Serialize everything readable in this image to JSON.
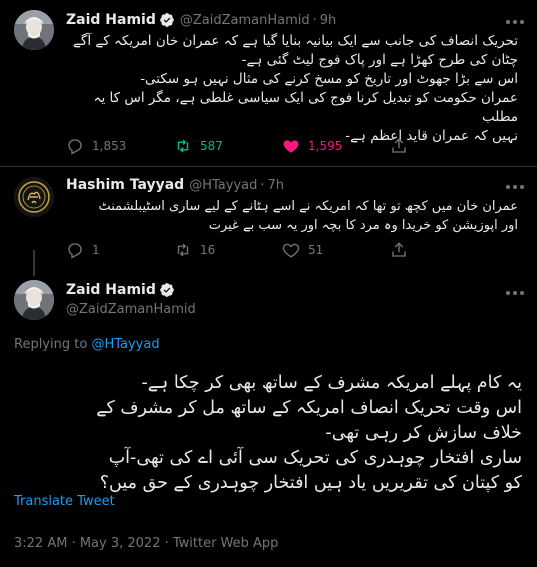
{
  "tweet1": {
    "name": "Zaid Hamid",
    "handle": "@ZaidZamanHamid",
    "sep": "·",
    "time": "9h",
    "lines": [
      "تحریک انصاف کی جانب سے ایک بیانیہ  بنایا گیا ہے کہ عمران خان امریکہ کے آگے",
      "چٹان کی طرح کھڑا ہے اور پاک فوج لیٹ گئی ہے-",
      "اس سے بڑا جھوٹ اور تاریخ کو مسخ کرنے کی مثال نہیں ہو سکتی-",
      "عمران حکومت کو تبدیل کرنا فوج کی ایک سیاسی غلطی ہے، مگر اس کا یہ مطلب",
      "نہیں کہ عمران قاید اعظم ہے-"
    ],
    "replies": "1,853",
    "retweets": "587",
    "likes": "1,595"
  },
  "tweet2": {
    "name": "Hashim Tayyad",
    "handle": "@HTayyad",
    "sep": "·",
    "time": "7h",
    "lines": [
      "عمران خان میں کچھ تو تھا کہ امریکہ نے اسے ہٹانے کے لیے ساری اسٹیبلشمنٹ",
      "اور اپوزیشن کو خریدا وہ مرد کا بچہ اور یہ سب بے غیرت"
    ],
    "replies": "1",
    "retweets": "16",
    "likes": "51"
  },
  "tweet3": {
    "name": "Zaid Hamid",
    "handle": "@ZaidZamanHamid",
    "replying_prefix": "Replying to",
    "replying_handle": "@HTayyad",
    "lines": [
      "یہ کام پہلے امریکہ مشرف کے ساتھ بھی کر چکا ہے-",
      "اس وقت تحریک انصاف امریکہ کے ساتھ مل کر مشرف کے",
      "خلاف سازش کر رہی تھی-",
      "ساری افتخار چوہدری کی تحریک سی آئی اے کی تھی-آپ",
      "کو کپتان کی تقریریں یاد ہیں افتخار چوہدری کے حق میں؟"
    ],
    "translate": "Translate Tweet",
    "meta": "3:22 AM · May 3, 2022 · Twitter Web App"
  },
  "colors": {
    "background": "#000000",
    "text": "#e7e9ea",
    "muted": "#71767b",
    "accent": "#1d9bf0",
    "retweet_active": "#00ba7c",
    "like_active": "#f91880"
  },
  "icons": [
    "verified-badge-icon",
    "more-icon",
    "reply-icon",
    "retweet-icon",
    "heart-icon"
  ]
}
